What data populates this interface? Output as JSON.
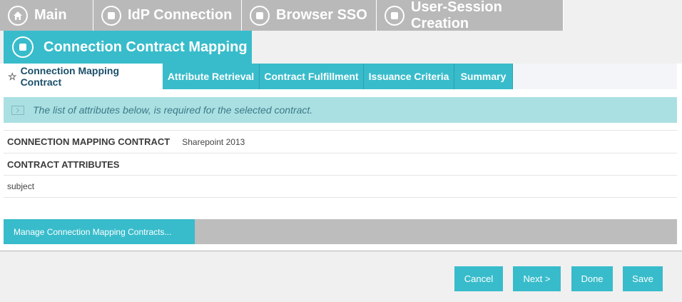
{
  "top_tabs": [
    {
      "label": "Main",
      "icon": "home-icon"
    },
    {
      "label": "IdP Connection",
      "icon": "step-icon"
    },
    {
      "label": "Browser SSO",
      "icon": "step-icon"
    },
    {
      "label": "User-Session Creation",
      "icon": "step-icon"
    }
  ],
  "active_step": {
    "label": "Connection Contract Mapping",
    "icon": "step-icon"
  },
  "sub_tabs": [
    {
      "label": "Connection Mapping Contract",
      "active": true
    },
    {
      "label": "Attribute Retrieval"
    },
    {
      "label": "Contract Fulfillment"
    },
    {
      "label": "Issuance Criteria"
    },
    {
      "label": "Summary"
    }
  ],
  "info_message": "The list of attributes below, is required for the selected contract.",
  "contract": {
    "label": "CONNECTION MAPPING CONTRACT",
    "value": "Sharepoint 2013"
  },
  "attributes": {
    "header": "CONTRACT ATTRIBUTES",
    "items": [
      "subject"
    ]
  },
  "manage_button": "Manage Connection Mapping Contracts...",
  "footer": {
    "cancel": "Cancel",
    "next": "Next >",
    "done": "Done",
    "save": "Save"
  },
  "colors": {
    "accent": "#38bccb",
    "inactive_tab": "#b9b9b9",
    "info_bg": "#abe0e3"
  }
}
